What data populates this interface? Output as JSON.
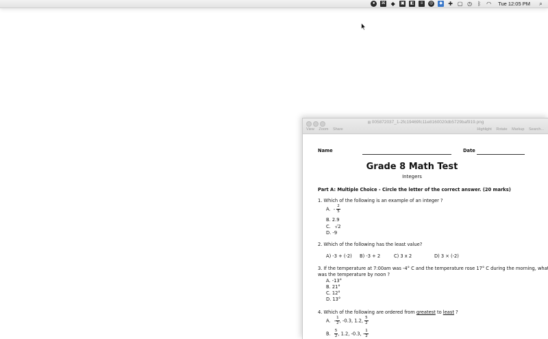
{
  "menubar": {
    "icons": [
      "record-icon",
      "app-icon",
      "dropbox-icon",
      "display-icon",
      "screenshot-icon",
      "stack-icon",
      "cc-icon",
      "dropbox-blue-icon",
      "settings-icon",
      "window-icon",
      "clock-icon",
      "bluetooth-icon",
      "wifi-icon"
    ],
    "clock": "Tue 12:05 PM",
    "search_icon": "search-icon"
  },
  "preview": {
    "title": "005872037_1-2fc19469fc11e8160020db5729baf919.png",
    "toolbar_left": [
      "View",
      "Zoom",
      "Share"
    ],
    "toolbar_right": [
      "Highlight",
      "Rotate",
      "Markup",
      "Search..."
    ]
  },
  "doc": {
    "name_label": "Name",
    "date_label": "Date",
    "title": "Grade 8 Math Test",
    "subtitle": "Integers",
    "part_a": "Part A:  Multiple Choice - Circle the letter of the correct answer.  (20 marks)",
    "q1": {
      "question": "1.   Which of the following is an example of an integer ?",
      "a_label": "A.",
      "a_sign": "-",
      "a_num": "2",
      "a_den": "5",
      "b": "B.  2.9",
      "c_label": "C.",
      "c_root": "√2",
      "d": "D.  -9"
    },
    "q2": {
      "question": "2. Which of the following has the least value?",
      "a": "A) -3 + (-2)",
      "b": "B) -3 + 2",
      "c": "C) 3 x 2",
      "d": "D) 3 × (-2)"
    },
    "q3": {
      "line1": "3.  If the temperature at 7:00am was -4° C and the temperature rose 17° C during the morning, what",
      "line2": "was the temperature by noon ?",
      "a": "A.  -13°",
      "b": "B.  21°",
      "c": "C.  12°",
      "d": "D.  13°"
    },
    "q4": {
      "pre": "4.  Which of the following are ordered from ",
      "greatest": "greatest",
      "mid": " to ",
      "least": "least",
      "post": " ?",
      "a_label": "A.",
      "a_part1": "-",
      "a_num1": "1",
      "a_den1": "2",
      "a_part2": ", -0.3, 1.2,",
      "a_num2": "5",
      "a_den2": "2",
      "b_label": "B.",
      "b_num1": "5",
      "b_den1": "2",
      "b_part2": ", 1.2, -0.3, -",
      "b_num2": "1",
      "b_den2": "2"
    }
  }
}
